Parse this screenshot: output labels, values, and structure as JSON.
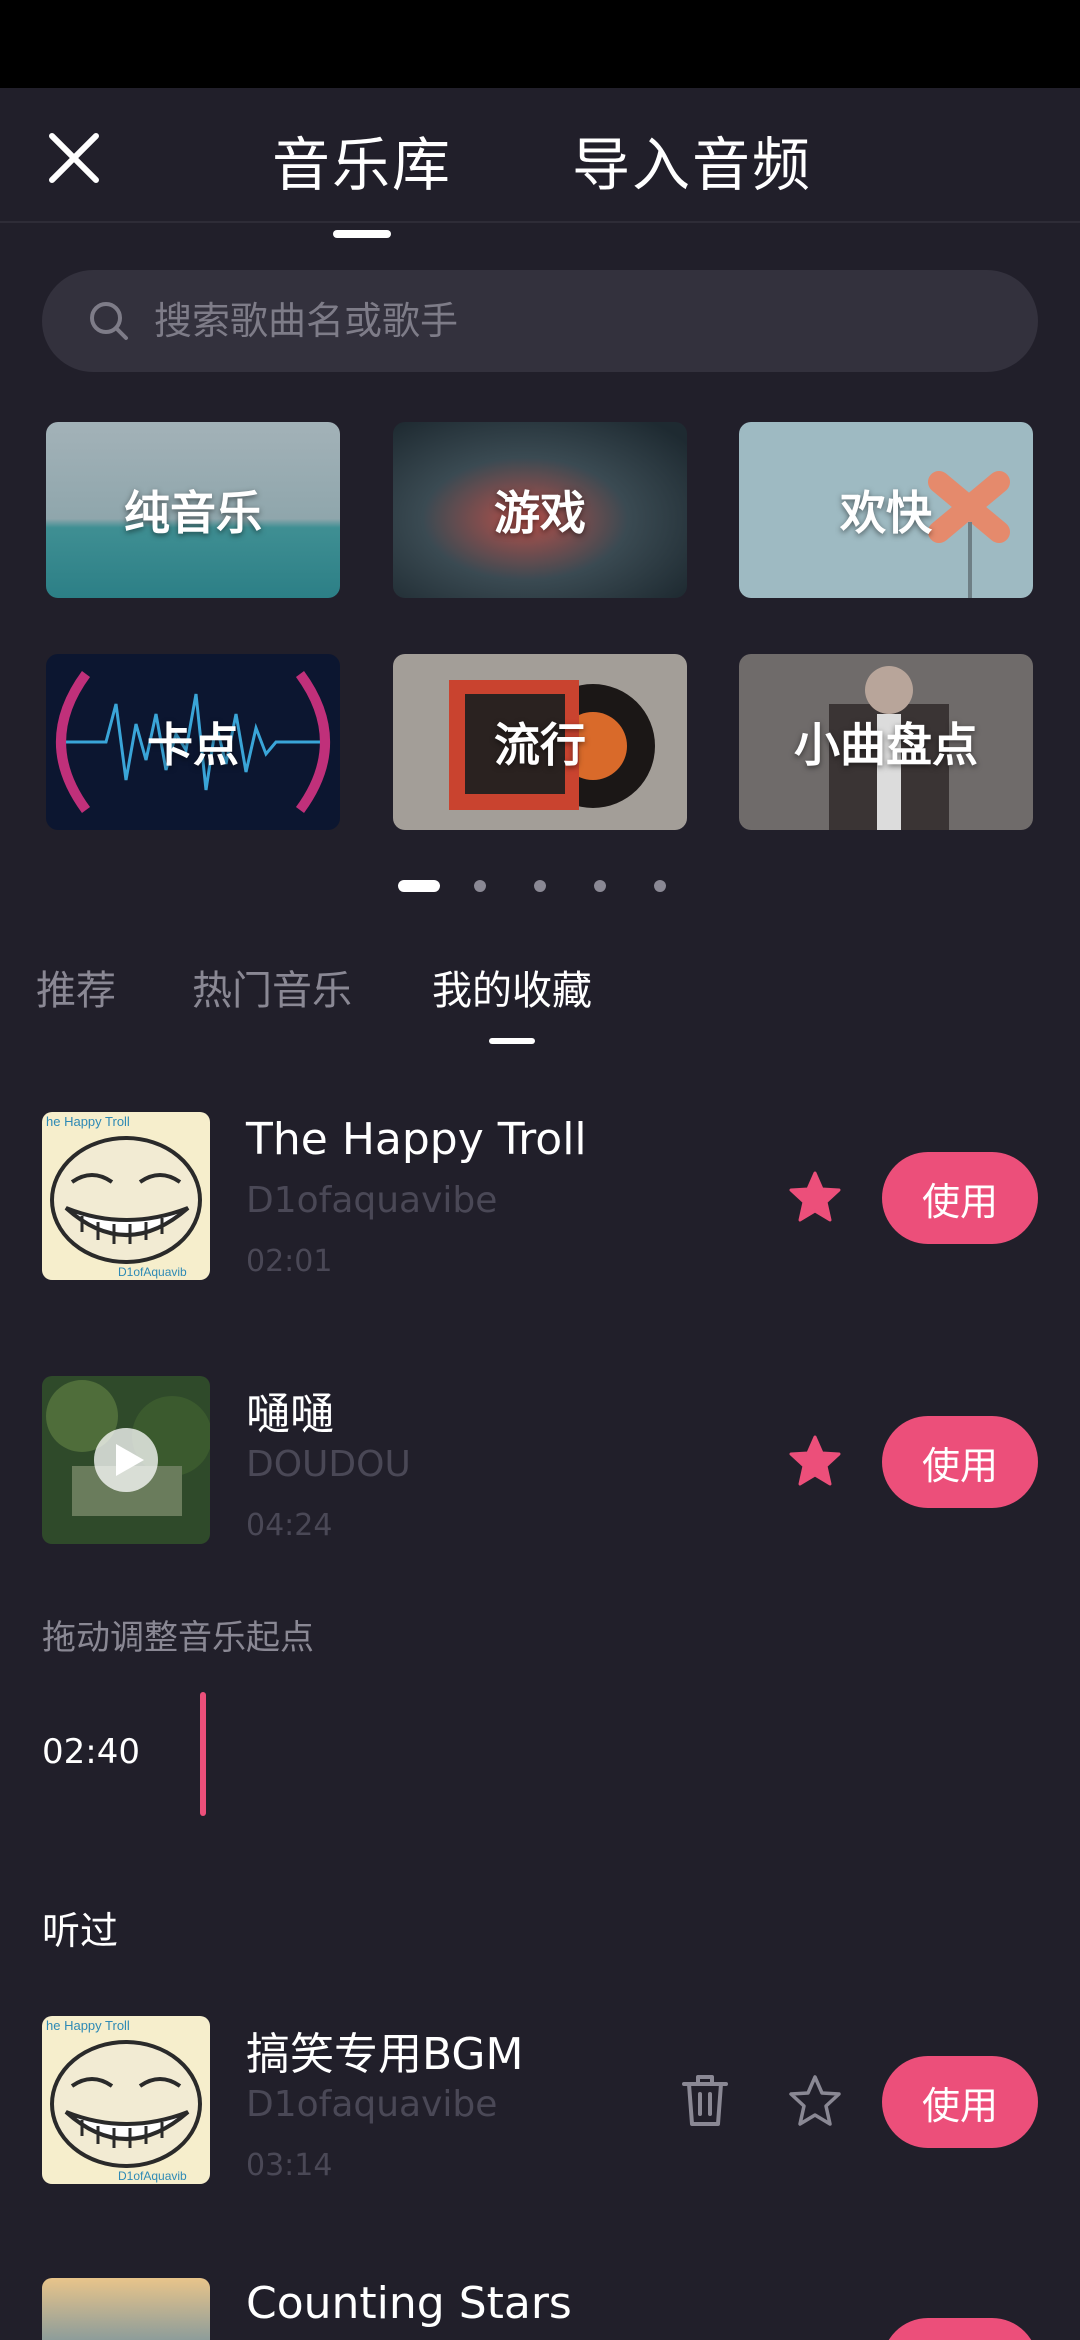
{
  "header": {
    "tabs": [
      {
        "label": "音乐库",
        "active": true
      },
      {
        "label": "导入音频",
        "active": false
      }
    ]
  },
  "search": {
    "placeholder": "搜索歌曲名或歌手"
  },
  "categories": [
    {
      "label": "纯音乐"
    },
    {
      "label": "游戏"
    },
    {
      "label": "欢快"
    },
    {
      "label": "卡点"
    },
    {
      "label": "流行"
    },
    {
      "label": "小曲盘点"
    }
  ],
  "pager": {
    "pages": 5,
    "active": 1
  },
  "subtabs": [
    {
      "label": "推荐"
    },
    {
      "label": "热门音乐"
    },
    {
      "label": "我的收藏",
      "active": true
    }
  ],
  "favorites": [
    {
      "title": "The Happy Troll",
      "artist": "D1ofaquavibe",
      "duration": "02:01",
      "use": "使用",
      "starred": true
    },
    {
      "title": "嗵嗵",
      "artist": "DOUDOU",
      "duration": "04:24",
      "use": "使用",
      "starred": true
    }
  ],
  "trim": {
    "hint": "拖动调整音乐起点",
    "time": "02:40"
  },
  "history": {
    "title": "听过",
    "items": [
      {
        "title": "搞笑专用BGM",
        "artist": "D1ofaquavibe",
        "duration": "03:14",
        "use": "使用",
        "starred": false
      },
      {
        "title": "Counting Stars"
      }
    ]
  },
  "cover_text": {
    "troll_top": "he Happy Troll",
    "troll_bottom": "D1ofAquavib"
  },
  "colors": {
    "background": "#211f2a",
    "accent": "#ec4f7a",
    "search_bg": "#33313d",
    "muted": "#8a8894"
  }
}
